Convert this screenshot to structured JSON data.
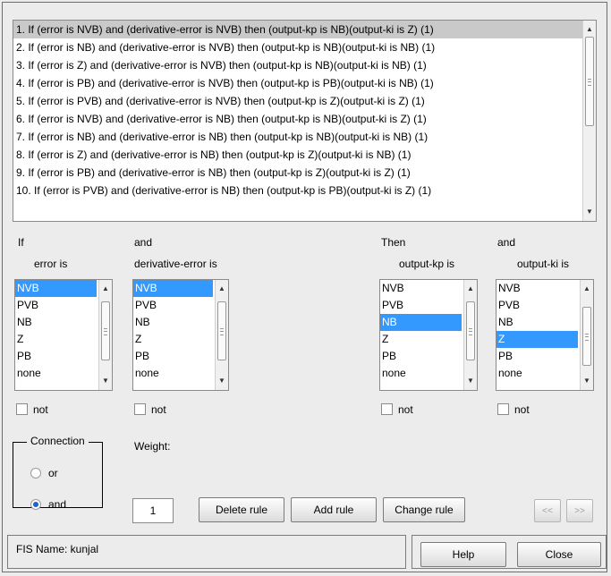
{
  "rules": [
    "1. If (error is NVB) and (derivative-error is NVB) then (output-kp is NB)(output-ki is Z) (1)",
    "2. If (error is NB) and (derivative-error is NVB) then (output-kp is NB)(output-ki is NB) (1)",
    "3. If (error is Z) and (derivative-error is NVB) then (output-kp is NB)(output-ki is NB) (1)",
    "4. If (error is PB) and (derivative-error is NVB) then (output-kp is PB)(output-ki is NB) (1)",
    "5. If (error is PVB) and (derivative-error is NVB) then (output-kp is Z)(output-ki is Z) (1)",
    "6. If (error is NVB) and (derivative-error is NB) then (output-kp is NB)(output-ki is Z) (1)",
    "7. If (error is NB) and (derivative-error is NB) then (output-kp is NB)(output-ki is NB) (1)",
    "8. If (error is Z) and (derivative-error is NB) then (output-kp is Z)(output-ki is NB) (1)",
    "9. If (error is PB) and (derivative-error is NB) then (output-kp is Z)(output-ki is Z) (1)",
    "10. If (error is PVB) and (derivative-error is NB) then (output-kp is PB)(output-ki is Z) (1)"
  ],
  "labels": {
    "if": "If",
    "and1": "and",
    "then": "Then",
    "and2": "and",
    "error_is": "error is",
    "derr_is": "derivative-error is",
    "kp_is": "output-kp is",
    "ki_is": "output-ki is",
    "not": "not",
    "connection": "Connection",
    "or": "or",
    "and": "and",
    "weight": "Weight:"
  },
  "lists": {
    "error": {
      "options": [
        "NVB",
        "PVB",
        "NB",
        "Z",
        "PB",
        "none"
      ],
      "selected": "NVB"
    },
    "derr": {
      "options": [
        "NVB",
        "PVB",
        "NB",
        "Z",
        "PB",
        "none"
      ],
      "selected": "NVB"
    },
    "kp": {
      "options": [
        "NVB",
        "PVB",
        "NB",
        "Z",
        "PB",
        "none"
      ],
      "selected": "NB"
    },
    "ki": {
      "options": [
        "NVB",
        "PVB",
        "NB",
        "Z",
        "PB",
        "none"
      ],
      "selected": "Z"
    }
  },
  "connection_selected": "and",
  "weight_value": "1",
  "buttons": {
    "delete": "Delete rule",
    "add": "Add rule",
    "change": "Change rule",
    "prev": "<<",
    "next": ">>",
    "help": "Help",
    "close": "Close"
  },
  "status": {
    "fis_name": "FIS Name: kunjal"
  },
  "colors": {
    "selection": "#3399ff",
    "rule_selection": "#c9c9c9",
    "background": "#ececec"
  }
}
